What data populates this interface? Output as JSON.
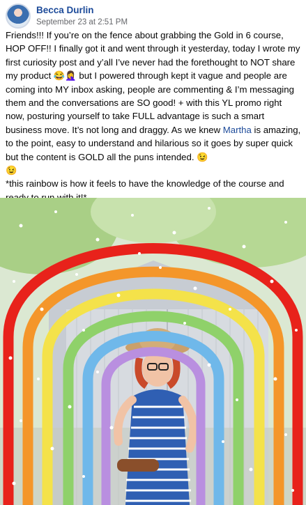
{
  "post": {
    "author": "Becca Durlin",
    "timestamp": "September 23 at 2:51 PM",
    "paragraph1_part1": "Friends!!! If you’re on the fence about grabbing the Gold in 6 course, HOP OFF!! I finally got it and went through it yesterday, today I wrote my first curiosity post and y’all I’ve never had the forethought to NOT share my product 😂🤦‍♀️ but I powered through kept it vague and people are coming into MY inbox asking, people are commenting & I’m messaging them and the conversations are SO good! + with this YL promo right now, posturing yourself to take FULL advantage is such a smart business move. It’s not long and draggy. As we knew ",
    "mention": "Martha",
    "paragraph1_part2": " is amazing, to the point, easy to understand and hilarious so it goes by super quick but the content is GOLD all the puns intended. 😉",
    "emoji_line": "😉",
    "paragraph2": "*this rainbow is how it feels to have the knowledge of the course and ready to run with it!*"
  },
  "colors": {
    "link": "#1c4a99",
    "timestamp": "#65676b",
    "rainbow": [
      "#e8221b",
      "#f4962a",
      "#f4e24a",
      "#8fd16a",
      "#6fb8ea",
      "#b98fe0"
    ]
  },
  "icons": {
    "avatar": "profile-photo"
  }
}
